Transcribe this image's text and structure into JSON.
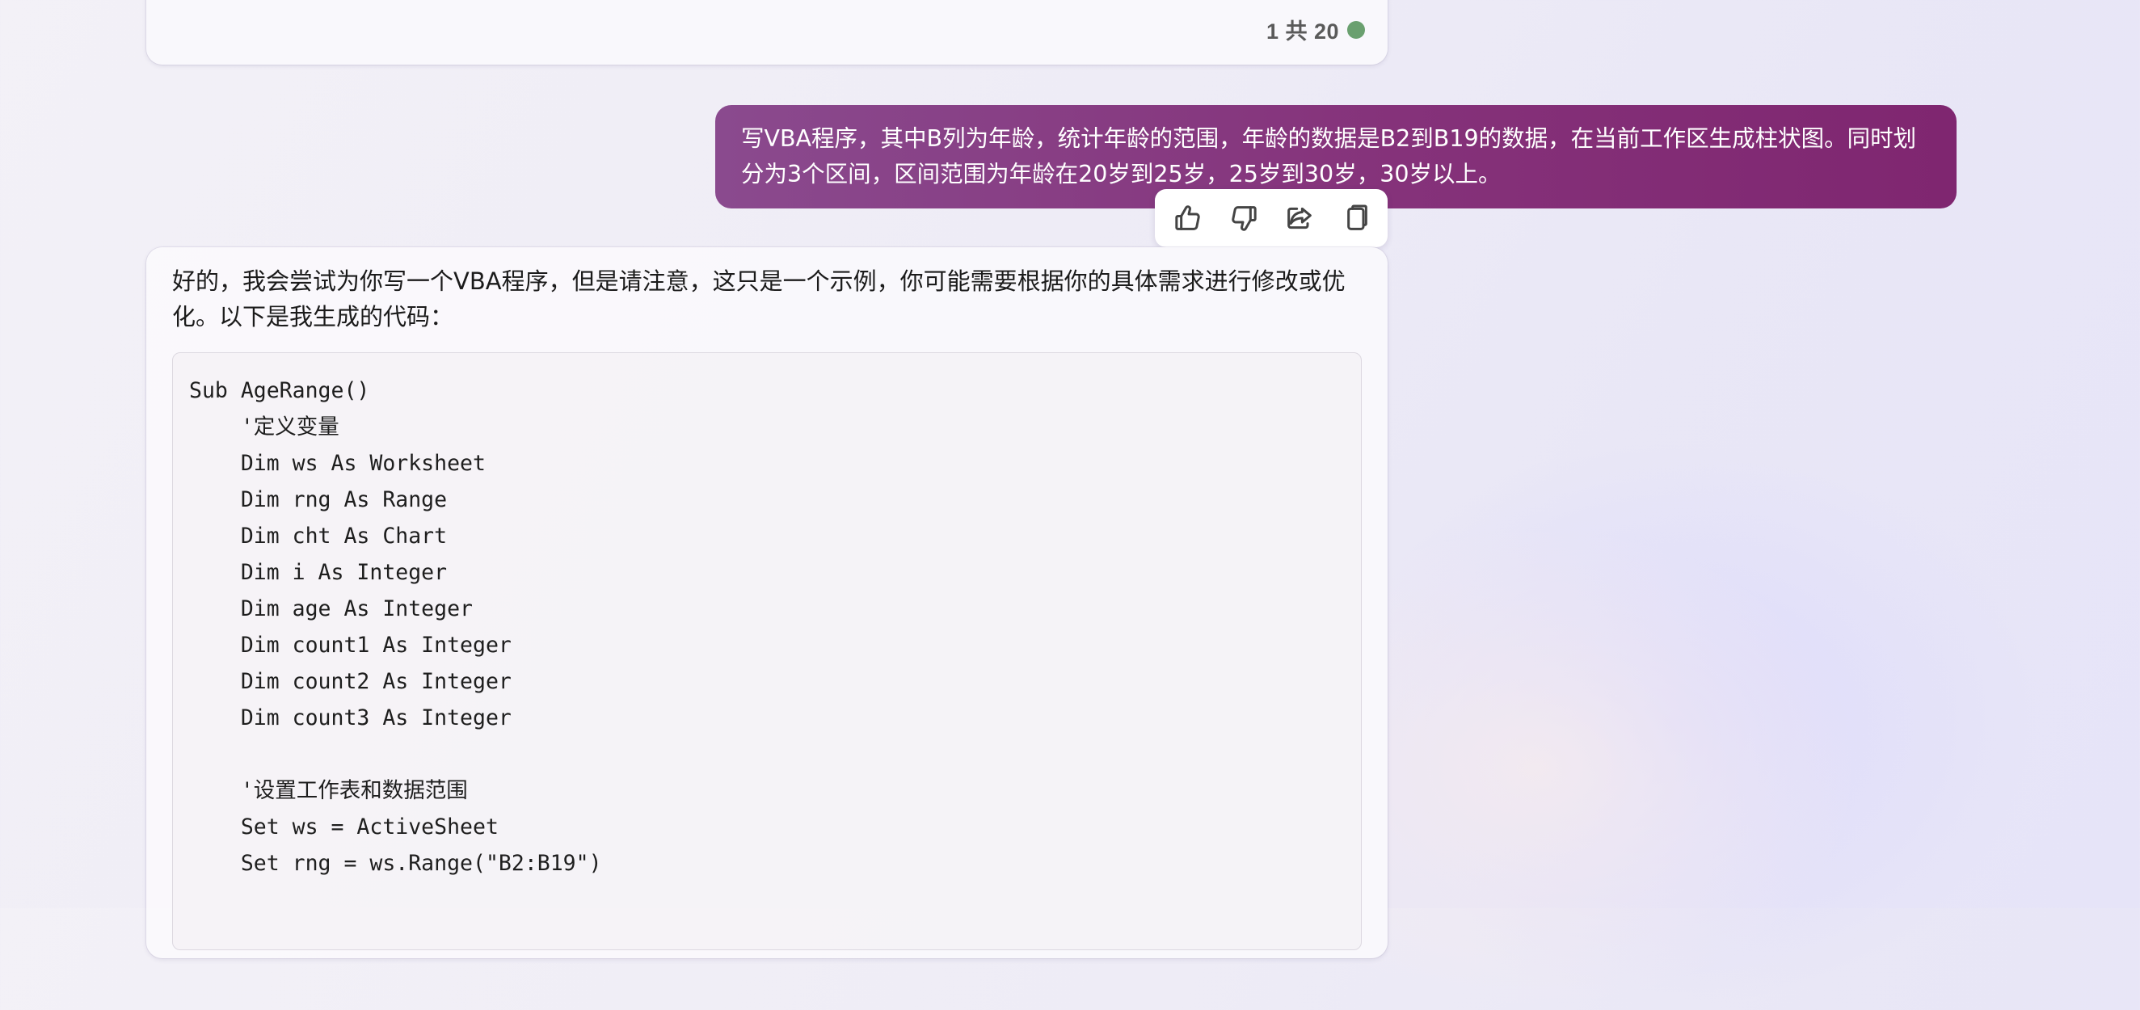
{
  "previous_message": {
    "turn_counter": "1 共 20",
    "status_color": "#6aa06f"
  },
  "user_message": {
    "text": "写VBA程序，其中B列为年龄，统计年龄的范围，年龄的数据是B2到B19的数据，在当前工作区生成柱状图。同时划分为3个区间，区间范围为年龄在20岁到25岁，25岁到30岁，30岁以上。",
    "bubble_color": "#85327a"
  },
  "reactions": [
    {
      "name": "thumbs-up-icon",
      "label": "like"
    },
    {
      "name": "thumbs-down-icon",
      "label": "dislike"
    },
    {
      "name": "share-icon",
      "label": "share"
    },
    {
      "name": "copy-icon",
      "label": "copy"
    }
  ],
  "bot_message": {
    "intro": "好的，我会尝试为你写一个VBA程序，但是请注意，这只是一个示例，你可能需要根据你的具体需求进行修改或优化。以下是我生成的代码：",
    "code_lines": [
      "Sub AgeRange()",
      "    '定义变量",
      "    Dim ws As Worksheet",
      "    Dim rng As Range",
      "    Dim cht As Chart",
      "    Dim i As Integer",
      "    Dim age As Integer",
      "    Dim count1 As Integer",
      "    Dim count2 As Integer",
      "    Dim count3 As Integer",
      "",
      "    '设置工作表和数据范围",
      "    Set ws = ActiveSheet",
      "    Set rng = ws.Range(\"B2:B19\")",
      "",
      ""
    ]
  }
}
